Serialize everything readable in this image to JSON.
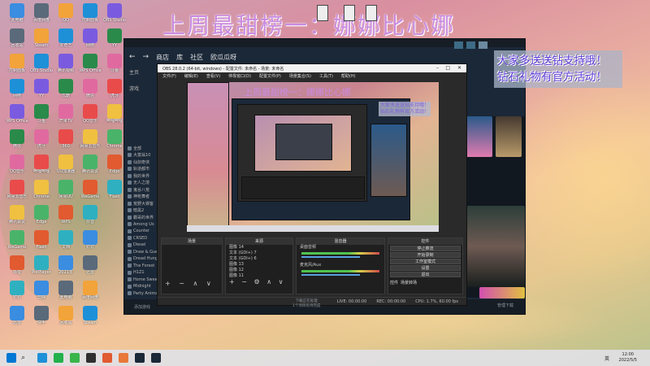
{
  "overlay": {
    "title": "上周最甜榜一：娜娜比心娜",
    "promo_line1": "大家多送送钻支持哦！",
    "promo_line2": "钻石礼物有官方活动！"
  },
  "steam": {
    "nav_store": "商店",
    "nav_library": "库",
    "nav_community": "社区",
    "nav_user": "欧瓜瓜呀",
    "home": "主页",
    "games": "游戏",
    "sidebar_items": [
      "全部",
      "大富翁10",
      "仙剑奇侠",
      "轨道都市",
      "我的世界",
      "无人之境",
      "鬼谷八荒",
      "神枪舞者",
      "荒野大镖客",
      "暗黑2",
      "霸哥的世界",
      "Among Us",
      "Counter",
      "CRSED",
      "Diesel",
      "Draw & Guess",
      "Dread Hunger",
      "The Forest",
      "H1Z1",
      "Home Sweet",
      "Midnight",
      "Party Animals"
    ],
    "add_game": "添加游戏",
    "manage_downloads": "管理下载"
  },
  "obs": {
    "title": "OBS 28.0.2 (64-bit, windows) - 配置文件: 未命名 - 场景: 未命名",
    "menu": [
      "文件(F)",
      "编辑(E)",
      "查看(V)",
      "停靠窗口(D)",
      "配置文件(P)",
      "场景集合(S)",
      "工具(T)",
      "帮助(H)"
    ],
    "panel_scenes": "场景",
    "panel_sources": "来源",
    "panel_mixer": "混音器",
    "panel_controls": "控件",
    "sources": [
      "图像 14",
      "文本 (GDI+) 7",
      "文本 (GDI+) 6",
      "图像 13",
      "图像 12",
      "图像 11"
    ],
    "mixer_track1": "桌面音频",
    "mixer_track2": "麦克风/Aux",
    "controls": [
      "停止推流",
      "开始录制",
      "工作室模式",
      "设置",
      "退出"
    ],
    "tab_controls": "控件",
    "tab_transitions": "场景转场",
    "status_live": "LIVE: 00:00:00",
    "status_rec": "REC: 00:00:00",
    "status_cpu": "CPU: 1.7%, 60.00 fps",
    "footer_a": "下载正在处理",
    "footer_b": "1个项目有待完成"
  },
  "desktop_labels": [
    "此电脑",
    "回收站",
    "控制面板",
    "网络",
    "WPS Office",
    "微信",
    "QQ音乐",
    "网易云音乐",
    "腾讯会议",
    "WeGame",
    "抖音",
    "钉钉",
    "迅雷",
    "百度网盘",
    "Steam",
    "OBS Studio",
    "YY",
    "斗鱼",
    "虎牙",
    "哔哩哔哩",
    "Chrome",
    "Edge",
    "Flash",
    "PotPlayer",
    "剪映",
    "快手",
    "QQ",
    "爱奇艺",
    "腾讯视频",
    "优酷",
    "芒果TV",
    "360",
    "UU加速器",
    "网易UU",
    "WPS",
    "文档",
    "2021年"
  ],
  "taskbar": {
    "lang": "英",
    "time": "12:00",
    "date": "2022/5/5"
  }
}
